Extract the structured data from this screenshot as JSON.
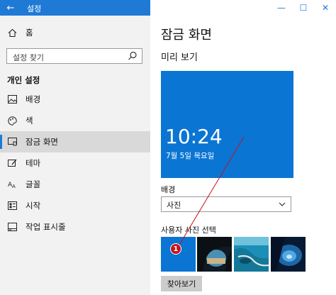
{
  "window": {
    "title": "설정",
    "back_icon": "←",
    "minimize_icon": "—",
    "maximize_icon": "☐",
    "close_icon": "✕"
  },
  "sidebar": {
    "home_label": "홈",
    "search_placeholder": "설정 찾기",
    "section_label": "개인 설정",
    "items": [
      {
        "label": "배경",
        "icon": "image-icon"
      },
      {
        "label": "색",
        "icon": "palette-icon"
      },
      {
        "label": "잠금 화면",
        "icon": "lock-screen-icon",
        "active": true
      },
      {
        "label": "테마",
        "icon": "brush-icon"
      },
      {
        "label": "글꼴",
        "icon": "font-icon"
      },
      {
        "label": "시작",
        "icon": "start-icon"
      },
      {
        "label": "작업 표시줄",
        "icon": "taskbar-icon"
      }
    ]
  },
  "main": {
    "page_title": "잠금 화면",
    "preview_heading": "미리 보기",
    "preview_time": "10:24",
    "preview_date": "7월 5일 목요일",
    "background_label": "배경",
    "background_value": "사진",
    "choose_picture_label": "사용자 사진 선택",
    "browse_button": "찾아보기",
    "annotation_number": "1",
    "thumbnails": [
      "blue-solid",
      "cave-beach",
      "aerial-coast",
      "underwater-cave"
    ]
  },
  "colors": {
    "accent": "#1f7ad6",
    "preview_bg": "#0a75d3",
    "annotation": "#c4141a"
  }
}
